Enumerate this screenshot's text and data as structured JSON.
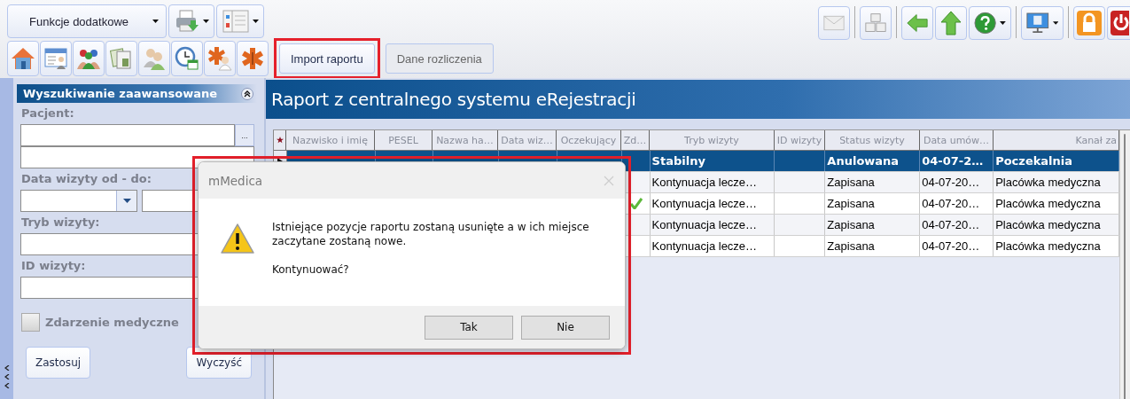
{
  "toolbar": {
    "menu_button": "Funkcje dodatkowe"
  },
  "tabs": [
    {
      "label": "Import raportu",
      "selected": true,
      "highlighted": true
    },
    {
      "label": "Dane rozliczenia",
      "selected": false,
      "highlighted": false
    }
  ],
  "sidebar": {
    "title": "Wyszukiwanie zaawansowane",
    "fields": [
      {
        "kind": "lookup",
        "label": "Pacjent:",
        "browse_button": "..."
      },
      {
        "kind": "date_range",
        "label": "Data wizyty od - do:"
      },
      {
        "kind": "text",
        "label": "Tryb wizyty:"
      },
      {
        "kind": "text",
        "label": "ID wizyty:"
      }
    ],
    "checkbox": {
      "label": "Zdarzenie medyczne",
      "checked": false
    },
    "buttons": [
      "Zastosuj",
      "Wyczyść"
    ]
  },
  "report": {
    "title": "Raport z centralnego systemu eRejestracji"
  },
  "table": {
    "columns": [
      "Nazwisko i imię",
      "PESEL",
      "Nazwa ha…",
      "Data wiz…",
      "Oczekujący",
      "Zd…",
      "Tryb wizyty",
      "ID wizyty",
      "Status wizyty",
      "Data umów…",
      "Kanał za"
    ],
    "rows": [
      {
        "selected": true,
        "zd_checked": false,
        "tryb_wizyty": "Stabilny",
        "status_wizyty": "Anulowana",
        "data_umowienia": "04-07-2…",
        "kanal": "Poczekalnia"
      },
      {
        "selected": false,
        "zd_checked": false,
        "tryb_wizyty": "Kontynuacja lecze…",
        "status_wizyty": "Zapisana",
        "data_umowienia": "04-07-20…",
        "kanal": "Placówka medyczna"
      },
      {
        "selected": false,
        "zd_checked": true,
        "tryb_wizyty": "Kontynuacja lecze…",
        "status_wizyty": "Zapisana",
        "data_umowienia": "04-07-20…",
        "kanal": "Placówka medyczna"
      },
      {
        "selected": false,
        "zd_checked": false,
        "tryb_wizyty": "Kontynuacja lecze…",
        "status_wizyty": "Zapisana",
        "data_umowienia": "04-07-20…",
        "kanal": "Placówka medyczna"
      },
      {
        "selected": false,
        "zd_checked": false,
        "tryb_wizyty": "Kontynuacja lecze…",
        "status_wizyty": "Zapisana",
        "data_umowienia": "04-07-20…",
        "kanal": "Placówka medyczna"
      }
    ]
  },
  "dialog": {
    "title": "mMedica",
    "message": "Istniejące pozycje raportu zostaną usunięte a w ich miejsce zaczytane zostaną nowe.",
    "question": "Kontynuować?",
    "buttons": [
      "Tak",
      "Nie"
    ],
    "highlighted": true
  }
}
